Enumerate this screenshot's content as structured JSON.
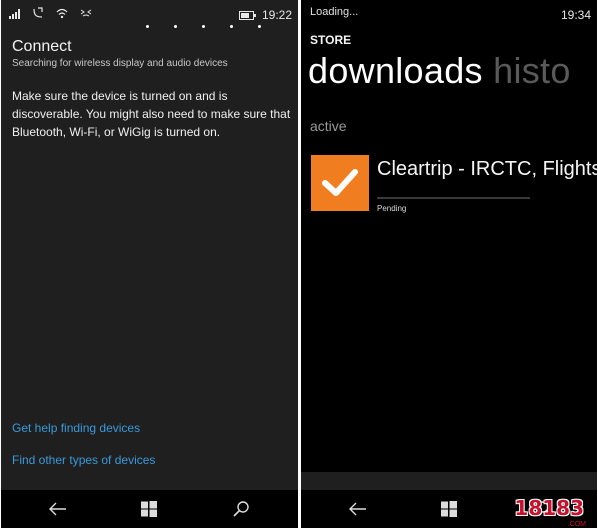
{
  "left": {
    "status_time": "19:22",
    "title": "Connect",
    "subtitle": "Searching for wireless display and audio devices",
    "description": "Make sure the device is turned on and is discoverable. You might also need to make sure that Bluetooth, Wi-Fi, or WiGig is turned on.",
    "links": [
      "Get help finding devices",
      "Find other types of devices"
    ],
    "nav_icons": [
      "back-icon",
      "windows-icon",
      "search-icon"
    ]
  },
  "right": {
    "loading": "Loading...",
    "status_time": "19:34",
    "store_label": "STORE",
    "pivot": {
      "active": "downloads",
      "inactive": "histo"
    },
    "section": "active",
    "download": {
      "app_name": "Cleartrip - IRCTC, Flights",
      "status": "Pending",
      "progress": 0
    },
    "nav_icons": [
      "back-icon",
      "windows-icon",
      "search-icon"
    ]
  },
  "watermark": {
    "text": "18183",
    "sub": ".COM"
  },
  "colors": {
    "link": "#3a9ad9",
    "app_tile": "#f07d1f",
    "left_bg": "#1f1f1f",
    "right_bg": "#000000"
  }
}
